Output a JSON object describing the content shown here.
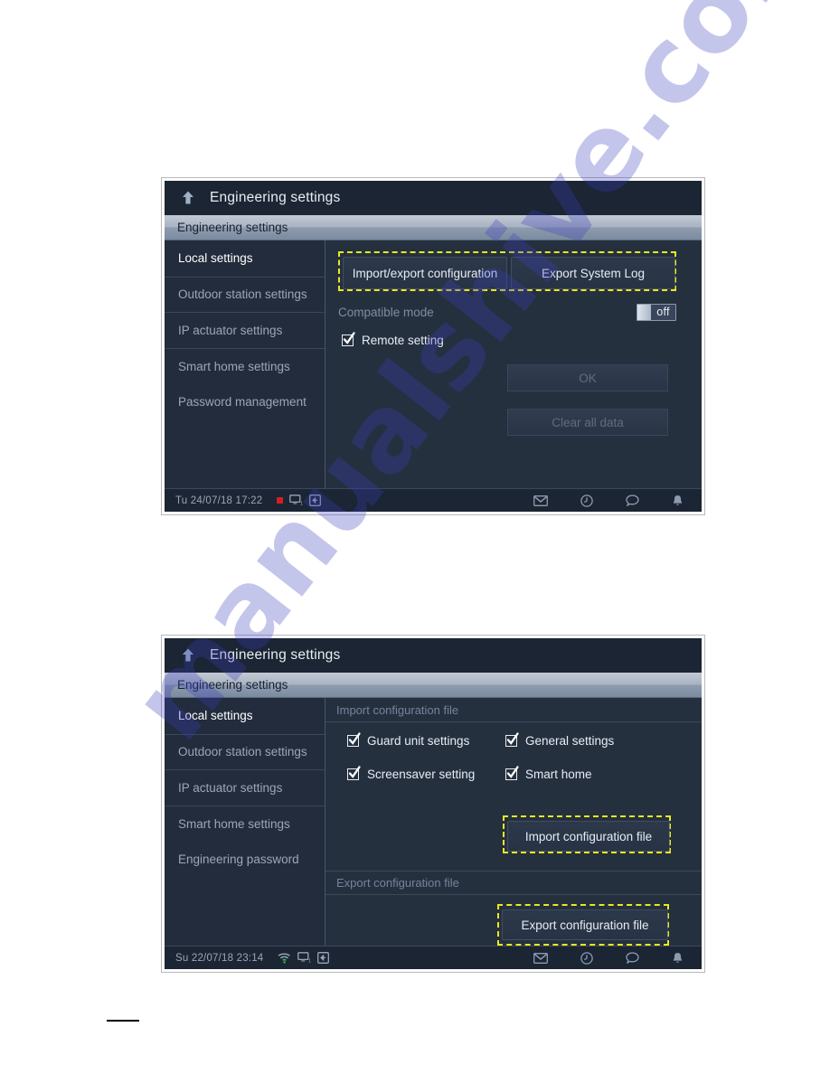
{
  "watermark": {
    "text": "manualshive.com",
    "color": "#3c3ebe"
  },
  "screens": [
    {
      "id": "screen-1",
      "titlebar": {
        "back_icon": "back-arrow-icon",
        "title": "Engineering settings"
      },
      "breadcrumb": "Engineering settings",
      "sidebar": [
        {
          "label": "Local settings",
          "active": true
        },
        {
          "label": "Outdoor station settings",
          "active": false
        },
        {
          "label": "IP actuator settings",
          "active": false
        },
        {
          "label": "Smart home settings",
          "active": false
        },
        {
          "label": "Password management",
          "active": false
        }
      ],
      "buttons": {
        "import_export_configuration": "Import/export configuration",
        "export_system_log": "Export System Log",
        "ok": "OK",
        "clear_all_data": "Clear all data"
      },
      "compatible_mode": {
        "label": "Compatible mode",
        "state": "off"
      },
      "remote_setting": {
        "label": "Remote setting",
        "checked": true
      },
      "statusbar": {
        "datetime": "Tu 24/07/18  17:22",
        "left_icons": [
          "record-dot-icon",
          "monitor-icon",
          "logout-icon"
        ],
        "right_icons": [
          "mail-icon",
          "history-icon",
          "chat-icon",
          "bell-icon"
        ]
      }
    },
    {
      "id": "screen-2",
      "titlebar": {
        "back_icon": "back-arrow-icon",
        "title": "Engineering settings"
      },
      "breadcrumb": "Engineering settings",
      "sidebar": [
        {
          "label": "Local settings",
          "active": true
        },
        {
          "label": "Outdoor station settings",
          "active": false
        },
        {
          "label": "IP actuator settings",
          "active": false
        },
        {
          "label": "Smart home settings",
          "active": false
        },
        {
          "label": "Engineering password",
          "active": false
        }
      ],
      "sections": {
        "import_heading": "Import configuration file",
        "export_heading": "Export configuration file"
      },
      "checkboxes": [
        {
          "label": "Guard unit settings",
          "checked": true
        },
        {
          "label": "General settings",
          "checked": true
        },
        {
          "label": "Screensaver setting",
          "checked": true
        },
        {
          "label": "Smart home",
          "checked": true
        }
      ],
      "buttons": {
        "import_configuration_file": "Import configuration file",
        "export_configuration_file": "Export configuration file"
      },
      "statusbar": {
        "datetime": "Su 22/07/18  23:14",
        "left_icons": [
          "wifi-icon",
          "monitor-icon",
          "logout-icon"
        ],
        "right_icons": [
          "mail-icon",
          "history-icon",
          "chat-icon",
          "bell-icon"
        ]
      }
    }
  ]
}
